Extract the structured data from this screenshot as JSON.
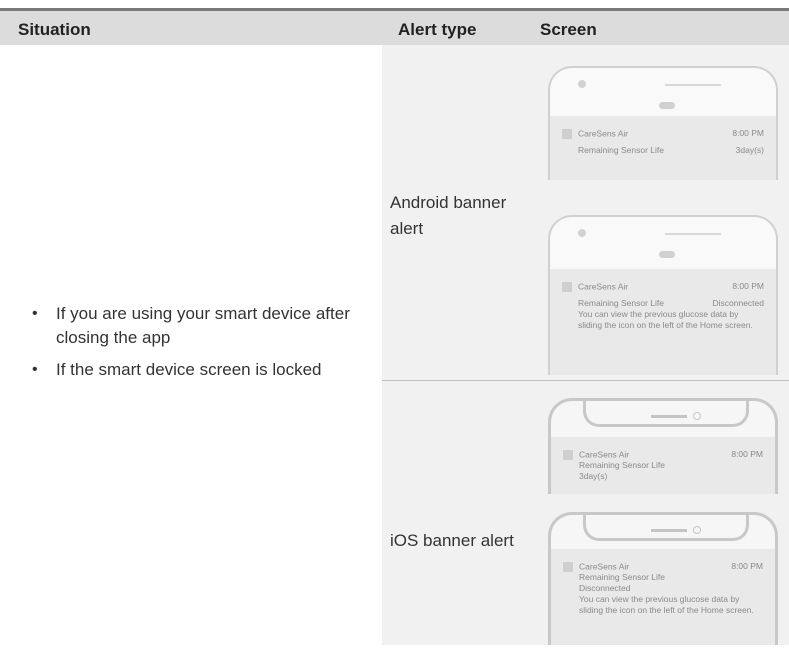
{
  "header": {
    "situation": "Situation",
    "alert_type": "Alert type",
    "screen": "Screen"
  },
  "situations": [
    "If you are using your smart device after closing the app",
    "If the smart device screen is locked"
  ],
  "bullet": "•",
  "alert_types": {
    "android": "Android banner alert",
    "ios": "iOS banner alert"
  },
  "screens": {
    "android_1": {
      "app": "CareSens Air",
      "time": "8:00 PM",
      "label": "Remaining Sensor Life",
      "value": "3day(s)"
    },
    "android_2": {
      "app": "CareSens Air",
      "time": "8:00 PM",
      "label": "Remaining Sensor Life",
      "value": "Disconnected",
      "message": "You can view the previous glucose data by sliding the icon on the left of the Home screen."
    },
    "ios_1": {
      "app": "CareSens Air",
      "time": "8:00 PM",
      "label": "Remaining Sensor Life",
      "value": "3day(s)"
    },
    "ios_2": {
      "app": "CareSens Air",
      "time": "8:00 PM",
      "label": "Remaining Sensor Life",
      "value": "Disconnected",
      "message": "You can view the previous glucose data by sliding the icon on the left of the Home screen."
    }
  },
  "colors": {
    "header_bg": "#dcdcdc",
    "header_rule": "#7a7a7a",
    "panel_bg": "#f1f1f1"
  }
}
